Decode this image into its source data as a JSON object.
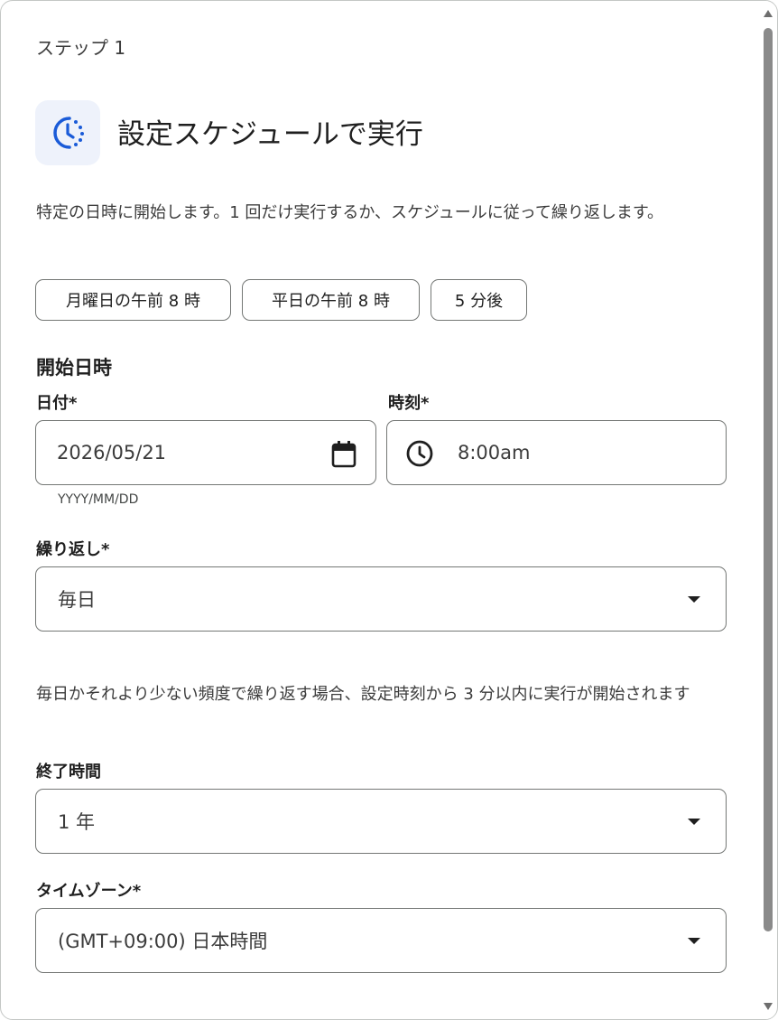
{
  "step_label": "ステップ 1",
  "header": {
    "title": "設定スケジュールで実行",
    "icon": "schedule-clock-icon",
    "accent_color": "#1a5bd8"
  },
  "description": "特定の日時に開始します。1 回だけ実行するか、スケジュールに従って繰り返します。",
  "quick_chips": [
    {
      "label": "月曜日の午前 8 時"
    },
    {
      "label": "平日の午前 8 時"
    },
    {
      "label": "5 分後"
    }
  ],
  "start": {
    "heading": "開始日時",
    "date": {
      "label": "日付*",
      "value": "2026/05/21",
      "helper": "YYYY/MM/DD",
      "icon": "calendar-icon"
    },
    "time": {
      "label": "時刻*",
      "value": "8:00am",
      "icon": "clock-icon"
    }
  },
  "repeat": {
    "label": "繰り返し*",
    "value": "毎日"
  },
  "note": "毎日かそれより少ない頻度で繰り返す場合、設定時刻から 3 分以内に実行が開始されます",
  "end": {
    "label": "終了時間",
    "value": "1 年"
  },
  "timezone": {
    "label": "タイムゾーン*",
    "value": "(GMT+09:00) 日本時間"
  }
}
